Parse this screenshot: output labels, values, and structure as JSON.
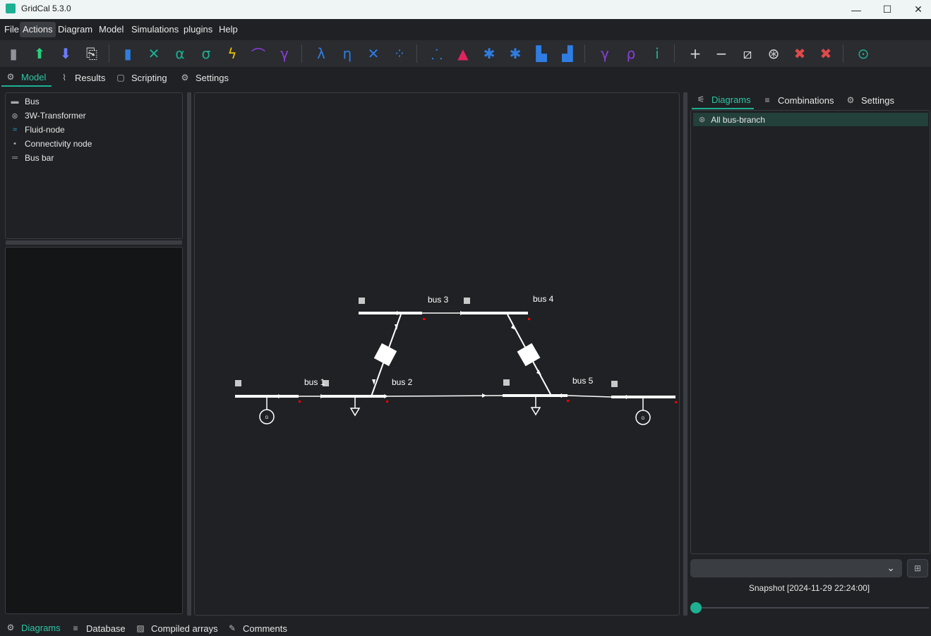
{
  "window": {
    "title": "GridCal 5.3.0",
    "minimize_glyph": "—",
    "maximize_glyph": "☐",
    "close_glyph": "✕"
  },
  "menubar": {
    "items": [
      "File",
      "Actions",
      "Diagram",
      "Model",
      "Simulations",
      "plugins",
      "Help"
    ]
  },
  "toolbar": {
    "groups": [
      [
        {
          "icon": "new-file-icon",
          "glyph": "▮",
          "color": "#8f9399"
        },
        {
          "icon": "upload-icon",
          "glyph": "⬆",
          "color": "#26d07c"
        },
        {
          "icon": "download-icon",
          "glyph": "⬇",
          "color": "#6b7cff"
        },
        {
          "icon": "export-icon",
          "glyph": "⎘",
          "color": "#d8d8d8"
        }
      ],
      [
        {
          "icon": "power-flow-icon",
          "glyph": "▮",
          "color": "#2f7de1"
        },
        {
          "icon": "optimal-flow-icon",
          "glyph": "✕",
          "color": "#1db093"
        },
        {
          "icon": "alpha-icon",
          "glyph": "α",
          "color": "#1db093"
        },
        {
          "icon": "sigma-icon",
          "glyph": "σ",
          "color": "#1db093"
        },
        {
          "icon": "short-circuit-icon",
          "glyph": "ϟ",
          "color": "#f2c200"
        },
        {
          "icon": "curve-icon",
          "glyph": "⌒",
          "color": "#8b3fd9"
        },
        {
          "icon": "gamma-icon",
          "glyph": "γ",
          "color": "#8b3fd9"
        }
      ],
      [
        {
          "icon": "lambda-icon",
          "glyph": "λ",
          "color": "#2f7de1"
        },
        {
          "icon": "eta-icon",
          "glyph": "η",
          "color": "#2f7de1"
        },
        {
          "icon": "clustering-icon",
          "glyph": "✕",
          "color": "#2f7de1"
        },
        {
          "icon": "scatter-icon",
          "glyph": "⁘",
          "color": "#2f7de1"
        }
      ],
      [
        {
          "icon": "time-series-icon",
          "glyph": "⸫",
          "color": "#2f7de1"
        },
        {
          "icon": "distribution-icon",
          "glyph": "▲",
          "color": "#e0245e"
        },
        {
          "icon": "stochastic-icon",
          "glyph": "✱",
          "color": "#2f7de1"
        },
        {
          "icon": "stochastic-alt-icon",
          "glyph": "✱",
          "color": "#2f7de1"
        },
        {
          "icon": "area-chart-icon",
          "glyph": "▙",
          "color": "#2f7de1"
        },
        {
          "icon": "landscape-icon",
          "glyph": "▟",
          "color": "#2f7de1"
        }
      ],
      [
        {
          "icon": "add-gamma-icon",
          "glyph": "γ",
          "color": "#8b3fd9"
        },
        {
          "icon": "add-rho-icon",
          "glyph": "ρ",
          "color": "#8b3fd9"
        },
        {
          "icon": "add-i-icon",
          "glyph": "i",
          "color": "#1db093"
        }
      ],
      [
        {
          "icon": "zoom-in-icon",
          "glyph": "+",
          "color": "#d8d8d8"
        },
        {
          "icon": "zoom-out-icon",
          "glyph": "−",
          "color": "#d8d8d8"
        },
        {
          "icon": "line-tool-icon",
          "glyph": "⧄",
          "color": "#d8d8d8"
        },
        {
          "icon": "grid-layout-icon",
          "glyph": "⊛",
          "color": "#d8d8d8"
        },
        {
          "icon": "delete-selected-icon",
          "glyph": "✖",
          "color": "#e04a4a"
        },
        {
          "icon": "delete-all-icon",
          "glyph": "✖",
          "color": "#e04a4a"
        }
      ],
      [
        {
          "icon": "inspect-icon",
          "glyph": "⊙",
          "color": "#1db093"
        }
      ]
    ]
  },
  "main_tabs": [
    {
      "label": "Model",
      "icon": "model-icon"
    },
    {
      "label": "Results",
      "icon": "results-icon"
    },
    {
      "label": "Scripting",
      "icon": "scripting-icon"
    },
    {
      "label": "Settings",
      "icon": "gear-icon"
    }
  ],
  "library": {
    "items": [
      {
        "label": "Bus",
        "icon": "bus-icon"
      },
      {
        "label": "3W-Transformer",
        "icon": "transformer-3w-icon"
      },
      {
        "label": "Fluid-node",
        "icon": "fluid-node-icon"
      },
      {
        "label": "Connectivity node",
        "icon": "connectivity-node-icon"
      },
      {
        "label": "Bus bar",
        "icon": "bus-bar-icon"
      }
    ]
  },
  "right_panel": {
    "tabs": [
      {
        "label": "Diagrams",
        "icon": "diagram-icon"
      },
      {
        "label": "Combinations",
        "icon": "list-icon"
      },
      {
        "label": "Settings",
        "icon": "gear-icon"
      }
    ],
    "selected_diagram": "All bus-branch",
    "combo_value": "",
    "snapshot": "Snapshot [2024-11-29 22:24:00]",
    "time_slider_position": 0
  },
  "bottom_tabs": [
    {
      "label": "Diagrams",
      "icon": "diagram-icon"
    },
    {
      "label": "Database",
      "icon": "database-icon"
    },
    {
      "label": "Compiled arrays",
      "icon": "arrays-icon"
    },
    {
      "label": "Comments",
      "icon": "pencil-icon"
    }
  ],
  "diagram": {
    "buses": [
      {
        "name": "bus 1"
      },
      {
        "name": "bus 2"
      },
      {
        "name": "bus 3"
      },
      {
        "name": "bus 4"
      },
      {
        "name": "bus 5"
      }
    ],
    "generator_label": "G"
  },
  "colors": {
    "accent": "#1db093",
    "background": "#1f2124",
    "diagram_line": "#ffffff",
    "node_marker": "#ff0000"
  }
}
